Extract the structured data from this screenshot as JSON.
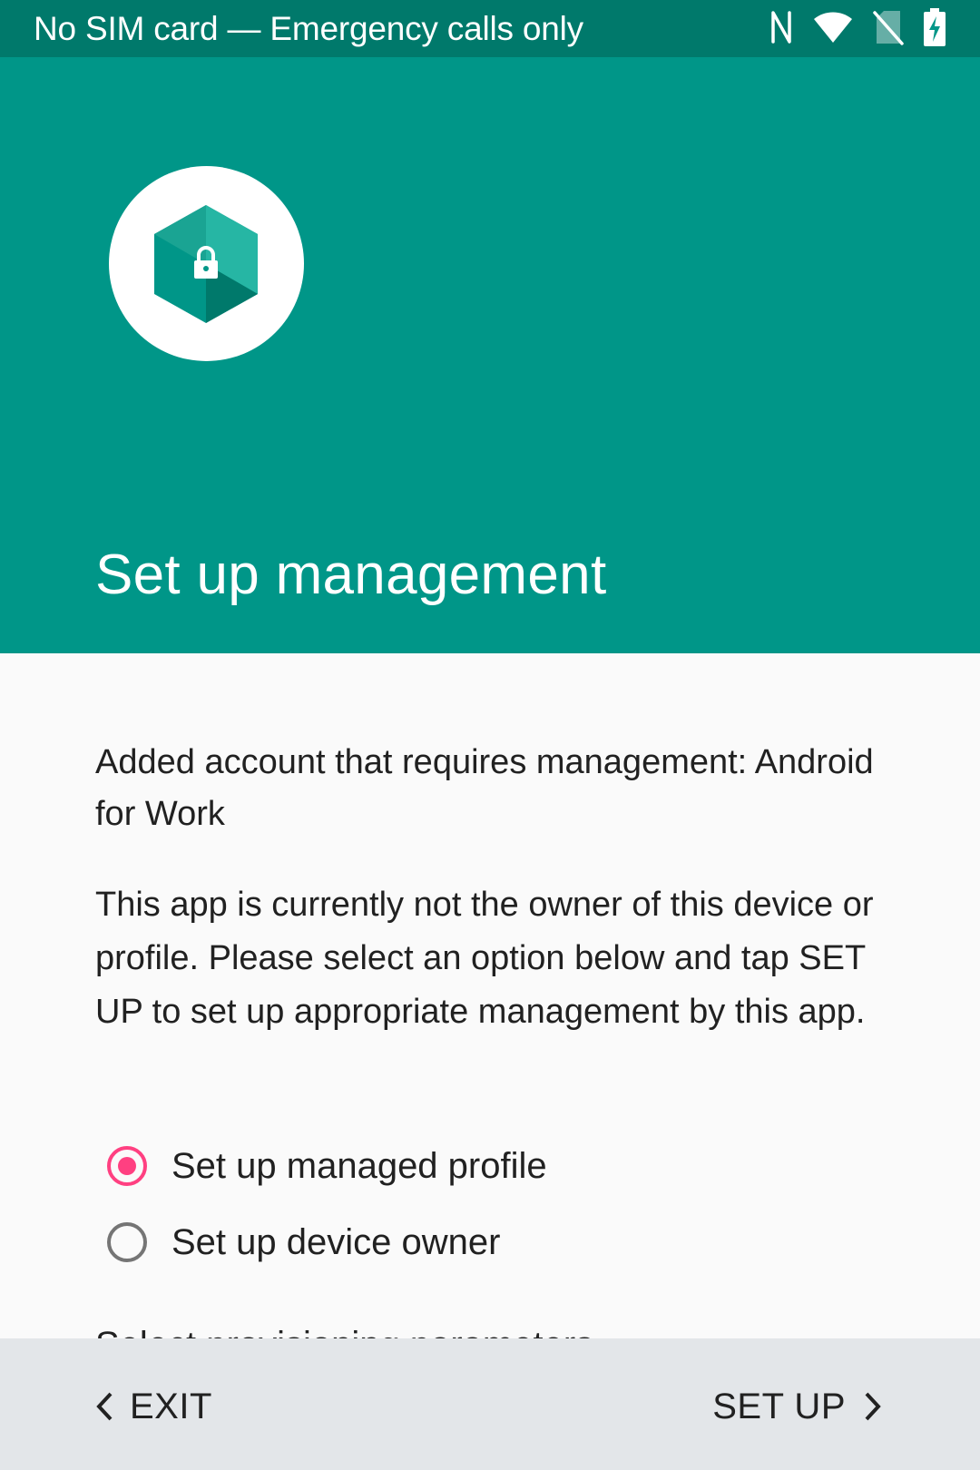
{
  "status_bar": {
    "text": "No SIM card — Emergency calls only",
    "icons": [
      "nfc-icon",
      "wifi-icon",
      "no-sim-icon",
      "battery-charging-icon"
    ]
  },
  "header": {
    "title": "Set up management",
    "logo_icon": "lock-hexagon-icon",
    "background_color": "#009688"
  },
  "body": {
    "account_message": "Added account that requires management: Android for Work",
    "description": "This app is currently not the owner of this device or profile. Please select an option below and tap SET UP to set up appropriate management by this app.",
    "options": [
      {
        "label": "Set up managed profile",
        "selected": true
      },
      {
        "label": "Set up device owner",
        "selected": false
      }
    ],
    "partially_visible_text": "Select provisioning parameters"
  },
  "footer": {
    "exit_label": "EXIT",
    "setup_label": "SET UP"
  },
  "colors": {
    "status_bar": "#00796b",
    "accent": "#ff4081",
    "footer": "#e3e6e9"
  }
}
